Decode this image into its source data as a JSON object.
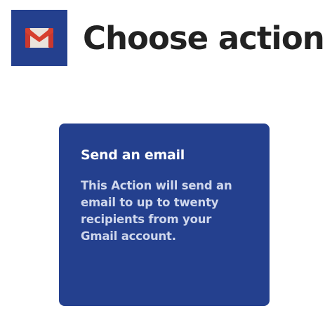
{
  "header": {
    "service_logo": {
      "icon": "gmail-icon",
      "background_color": "#24408e"
    },
    "title": "Choose action"
  },
  "actions": [
    {
      "title": "Send an email",
      "description": "This Action will send an email to up to twenty recipients from your Gmail account.",
      "background_color": "#24408e"
    }
  ]
}
